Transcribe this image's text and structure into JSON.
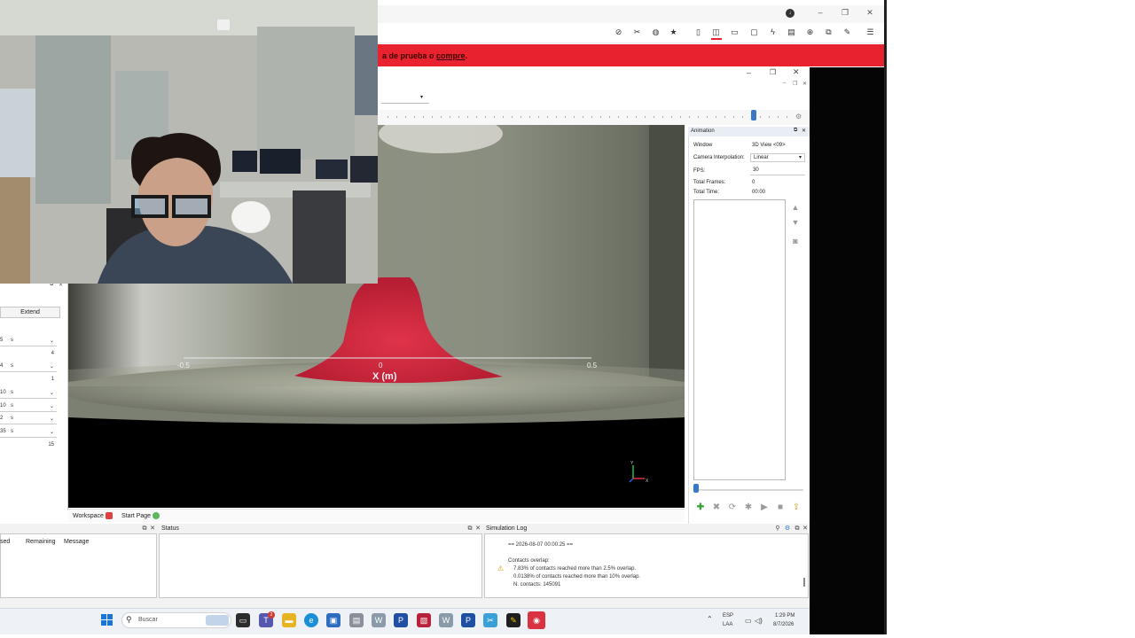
{
  "banner": {
    "text_part1": "a de prueba o ",
    "text_link": "compre",
    "text_end": "."
  },
  "browser": {
    "profile_initial": "↓",
    "window_controls": [
      "–",
      "❐",
      "✕"
    ],
    "toolbar_icons": [
      "no-image-icon",
      "cut-icon",
      "database-icon",
      "star-icon",
      "document-icon",
      "reader-icon",
      "window-icon",
      "comment-icon",
      "bolt-icon",
      "keyboard-icon",
      "globe-icon",
      "extension-icon",
      "pen-icon",
      "menu-icon"
    ]
  },
  "left_panel": {
    "extend_label": "Extend",
    "rows": [
      {
        "num": "5",
        "unit": "s",
        "value": "",
        "dropdown": true
      },
      {
        "num": "",
        "unit": "",
        "value": "4",
        "dropdown": false
      },
      {
        "num": "4",
        "unit": "s",
        "value": "",
        "dropdown": true
      },
      {
        "num": "",
        "unit": "",
        "value": "1",
        "dropdown": false
      },
      {
        "num": "10",
        "unit": "s",
        "value": "",
        "dropdown": true
      },
      {
        "num": "10",
        "unit": "s",
        "value": "",
        "dropdown": true
      },
      {
        "num": "2",
        "unit": "s",
        "value": "",
        "dropdown": true
      },
      {
        "num": "35",
        "unit": "s",
        "value": "",
        "dropdown": true
      },
      {
        "num": "",
        "unit": "",
        "value": "15",
        "dropdown": false
      }
    ]
  },
  "viewport": {
    "axis_label": "X (m)",
    "tick_left": "-0.5",
    "tick_mid": "0",
    "tick_right": "0.5",
    "gizmo_y": "Y",
    "gizmo_x": "X"
  },
  "workspace_tabs": {
    "workspace": "Workspace",
    "start_page": "Start Page"
  },
  "animation": {
    "title": "Animation",
    "window_label": "Window",
    "window_value": "3D View <09>",
    "camera_label": "Camera Interpolation:",
    "camera_value": "Linear",
    "fps_label": "FPS:",
    "fps_value": "30",
    "frames_label": "Total Frames:",
    "frames_value": "0",
    "time_label": "Total Time:",
    "time_value": "00:00"
  },
  "bottom": {
    "jobs_col_1": "sed",
    "jobs_col_2": "Remaining",
    "jobs_col_3": "Message",
    "status_title": "Status",
    "log_title": "Simulation Log",
    "log_timestamp": "== 2026-08-07 00:00:25 ==",
    "log_heading": "Contacts overlap:",
    "log_line1": "7.83% of contacts reached more than 2.5% overlap.",
    "log_line2": "0.0138% of contacts reached more than 10% overlap.",
    "log_line3": "N. contacts: 145091"
  },
  "taskbar": {
    "search_placeholder": "Buscar",
    "lang_top": "ESP",
    "lang_bottom": "LAA",
    "time": "1:29 PM",
    "date": "8/7/2026",
    "teams_badge": "2"
  },
  "colors": {
    "banner_red": "#e8222e",
    "particles_red": "#d2263b",
    "accent_blue": "#3a78c6"
  }
}
